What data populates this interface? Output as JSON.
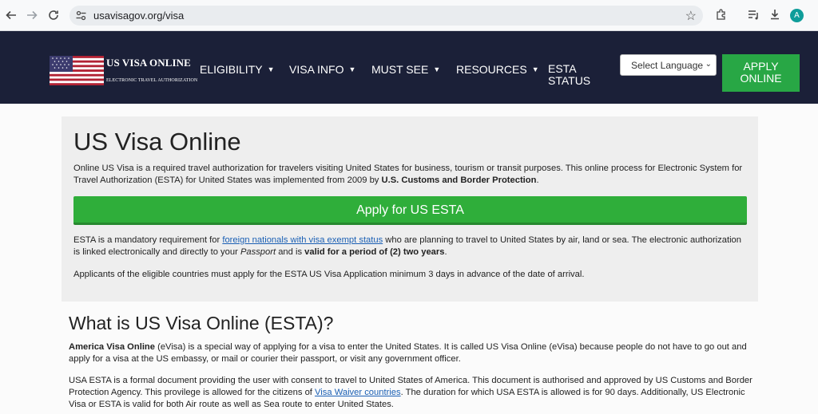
{
  "browser": {
    "url": "usavisagov.org/visa",
    "avatar_letter": "A"
  },
  "header": {
    "logo_title": "US VISA ONLINE",
    "logo_subtitle": "ELECTRONIC TRAVEL AUTHORIZATION",
    "menu": [
      {
        "label": "ELIGIBILITY"
      },
      {
        "label": "VISA INFO"
      },
      {
        "label": "MUST SEE"
      },
      {
        "label": "RESOURCES"
      }
    ],
    "esta_line1": "ESTA",
    "esta_line2": "STATUS",
    "language_select": "Select Language",
    "apply_line1": "APPLY",
    "apply_line2": "ONLINE"
  },
  "hero": {
    "title": "US Visa Online",
    "intro_start": "Online US Visa is a required travel authorization for travelers visiting United States for business, tourism or transit purposes. This online process for Electronic System for Travel Authorization (ESTA) for United States was implemented from 2009 by ",
    "intro_bold": "U.S. Customs and Border Protection",
    "intro_end": ".",
    "cta_label": "Apply for US ESTA",
    "p2_start": "ESTA is a mandatory requirement for ",
    "p2_link": "foreign nationals with visa exempt status",
    "p2_mid": " who are planning to travel to United States by air, land or sea. The electronic authorization is linked electronically and directly to your ",
    "p2_italic": "Passport",
    "p2_mid2": " and is ",
    "p2_bold": "valid for a period of (2) two years",
    "p2_end": ".",
    "p3": "Applicants of the eligible countries must apply for the ESTA US Visa Application minimum 3 days in advance of the date of arrival."
  },
  "section": {
    "title": "What is US Visa Online (ESTA)?",
    "p4_bold": "America Visa Online",
    "p4_rest": " (eVisa) is a special way of applying for a visa to enter the United States. It is called US Visa Online (eVisa) because people do not have to go out and apply for a visa at the US embassy, or mail or courier their passport, or visit any government officer.",
    "p5_start": "USA ESTA is a formal document providing the user with consent to travel to United States of America. This document is authorised and approved by US Customs and Border Protection Agency. This provilege is allowed for the citizens of ",
    "p5_link": "Visa Waiver countries",
    "p5_end": ". The duration for which USA ESTA is allowed is for 90 days. Additionally, US Electronic Visa or ESTA is valid for both Air route as well as Sea route to enter United States."
  }
}
